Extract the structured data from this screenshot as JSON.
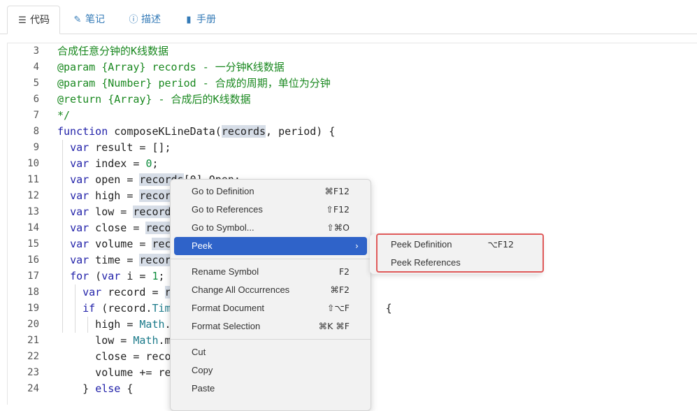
{
  "tabs": [
    {
      "icon": "list-icon",
      "glyph": "☰",
      "label": "代码"
    },
    {
      "icon": "edit-icon",
      "glyph": "✎",
      "label": "笔记"
    },
    {
      "icon": "info-icon",
      "glyph": "ⓘ",
      "label": "描述"
    },
    {
      "icon": "book-icon",
      "glyph": "▮",
      "label": "手册"
    }
  ],
  "code_lines": [
    {
      "n": "3",
      "tokens": [
        {
          "t": "合成任意分钟的K线数据",
          "c": "c"
        }
      ]
    },
    {
      "n": "4",
      "tokens": [
        {
          "t": "@param {Array} records - 一分钟K线数据",
          "c": "c"
        }
      ]
    },
    {
      "n": "5",
      "tokens": [
        {
          "t": "@param {Number} period - 合成的周期，单位为分钟",
          "c": "c"
        }
      ]
    },
    {
      "n": "6",
      "tokens": [
        {
          "t": "@return {Array} - 合成后的K线数据",
          "c": "c"
        }
      ]
    },
    {
      "n": "7",
      "tokens": [
        {
          "t": "*/",
          "c": "c"
        }
      ]
    },
    {
      "n": "8",
      "tokens": [
        {
          "t": "function",
          "c": "k"
        },
        {
          "t": " composeKLineData("
        },
        {
          "t": "records",
          "c": "hl"
        },
        {
          "t": ", period) {"
        }
      ]
    },
    {
      "n": "9",
      "tokens": [
        {
          "t": "  "
        },
        {
          "t": "var",
          "c": "k"
        },
        {
          "t": " result = [];"
        }
      ]
    },
    {
      "n": "10",
      "tokens": [
        {
          "t": "  "
        },
        {
          "t": "var",
          "c": "k"
        },
        {
          "t": " index = "
        },
        {
          "t": "0",
          "c": "n"
        },
        {
          "t": ";"
        }
      ]
    },
    {
      "n": "11",
      "tokens": [
        {
          "t": "  "
        },
        {
          "t": "var",
          "c": "k"
        },
        {
          "t": " open = "
        },
        {
          "t": "records",
          "c": "hl"
        },
        {
          "t": "[0].Open;"
        }
      ]
    },
    {
      "n": "12",
      "tokens": [
        {
          "t": "  "
        },
        {
          "t": "var",
          "c": "k"
        },
        {
          "t": " high = "
        },
        {
          "t": "recor",
          "c": "hl"
        }
      ]
    },
    {
      "n": "13",
      "tokens": [
        {
          "t": "  "
        },
        {
          "t": "var",
          "c": "k"
        },
        {
          "t": " low = "
        },
        {
          "t": "record",
          "c": "hl"
        }
      ]
    },
    {
      "n": "14",
      "tokens": [
        {
          "t": "  "
        },
        {
          "t": "var",
          "c": "k"
        },
        {
          "t": " close = "
        },
        {
          "t": "reco",
          "c": "hl"
        }
      ]
    },
    {
      "n": "15",
      "tokens": [
        {
          "t": "  "
        },
        {
          "t": "var",
          "c": "k"
        },
        {
          "t": " volume = "
        },
        {
          "t": "rec",
          "c": "hl"
        }
      ]
    },
    {
      "n": "16",
      "tokens": [
        {
          "t": "  "
        },
        {
          "t": "var",
          "c": "k"
        },
        {
          "t": " time = "
        },
        {
          "t": "recor",
          "c": "hl"
        }
      ]
    },
    {
      "n": "17",
      "tokens": [
        {
          "t": "  "
        },
        {
          "t": "for",
          "c": "k"
        },
        {
          "t": " ("
        },
        {
          "t": "var",
          "c": "k"
        },
        {
          "t": " i = "
        },
        {
          "t": "1",
          "c": "n"
        },
        {
          "t": ";"
        }
      ]
    },
    {
      "n": "18",
      "tokens": [
        {
          "t": "    "
        },
        {
          "t": "var",
          "c": "k"
        },
        {
          "t": " record = "
        },
        {
          "t": "r",
          "c": "hl"
        }
      ]
    },
    {
      "n": "19",
      "tokens": [
        {
          "t": "    "
        },
        {
          "t": "if",
          "c": "k"
        },
        {
          "t": " (record."
        },
        {
          "t": "Tim",
          "c": "t"
        },
        {
          "t": "                                  {"
        }
      ]
    },
    {
      "n": "20",
      "tokens": [
        {
          "t": "      high = "
        },
        {
          "t": "Math",
          "c": "t"
        },
        {
          "t": "."
        }
      ]
    },
    {
      "n": "21",
      "tokens": [
        {
          "t": "      low = "
        },
        {
          "t": "Math",
          "c": "t"
        },
        {
          "t": ".m"
        }
      ]
    },
    {
      "n": "22",
      "tokens": [
        {
          "t": "      close = reco"
        }
      ]
    },
    {
      "n": "23",
      "tokens": [
        {
          "t": "      volume += re"
        }
      ]
    },
    {
      "n": "24",
      "tokens": [
        {
          "t": "    } "
        },
        {
          "t": "else",
          "c": "k"
        },
        {
          "t": " {"
        }
      ]
    }
  ],
  "context_menu": {
    "groups": [
      [
        {
          "label": "Go to Definition",
          "shortcut": "⌘F12"
        },
        {
          "label": "Go to References",
          "shortcut": "⇧F12"
        },
        {
          "label": "Go to Symbol...",
          "shortcut": "⇧⌘O"
        },
        {
          "label": "Peek",
          "shortcut": "",
          "submenu": true,
          "selected": true
        }
      ],
      [
        {
          "label": "Rename Symbol",
          "shortcut": "F2"
        },
        {
          "label": "Change All Occurrences",
          "shortcut": "⌘F2"
        },
        {
          "label": "Format Document",
          "shortcut": "⇧⌥F"
        },
        {
          "label": "Format Selection",
          "shortcut": "⌘K ⌘F"
        }
      ],
      [
        {
          "label": "Cut",
          "shortcut": ""
        },
        {
          "label": "Copy",
          "shortcut": ""
        },
        {
          "label": "Paste",
          "shortcut": ""
        }
      ]
    ],
    "submenu_arrow": "›"
  },
  "peek_submenu": [
    {
      "label": "Peek Definition",
      "shortcut": "⌥F12"
    },
    {
      "label": "Peek References",
      "shortcut": ""
    }
  ],
  "colors": {
    "accent": "#2f63c9",
    "highlight_box": "#e05a5a",
    "comment": "#19881f",
    "keyword": "#1f1fa8"
  }
}
